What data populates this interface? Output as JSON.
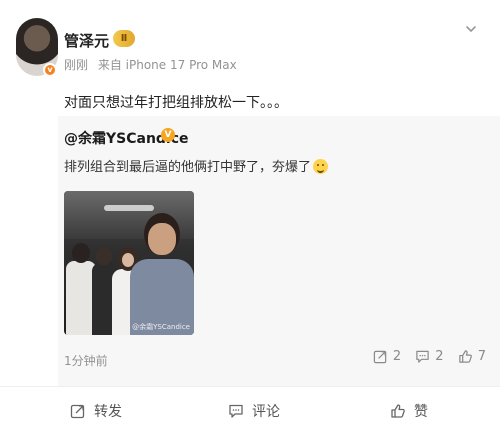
{
  "post": {
    "username": "管泽元",
    "vip_badge": "Ⅱ",
    "time": "刚刚",
    "source": "来自 iPhone 17 Pro Max",
    "text": "对面只想过年打把组排放松一下。。。"
  },
  "repost": {
    "author": "@余霜YSCandice",
    "verified": "V",
    "text": "排列组合到最后逼的他俩打中野了，夯爆了",
    "image_watermark": "@余霜YSCandice",
    "time": "1分钟前",
    "stats": {
      "reposts": "2",
      "comments": "2",
      "likes": "7"
    }
  },
  "actions": {
    "repost_label": "转发",
    "comment_label": "评论",
    "like_label": "赞"
  },
  "colors": {
    "accent_orange": "#f58220",
    "gray_text": "#939393",
    "repost_bg": "#f7f7f7"
  }
}
